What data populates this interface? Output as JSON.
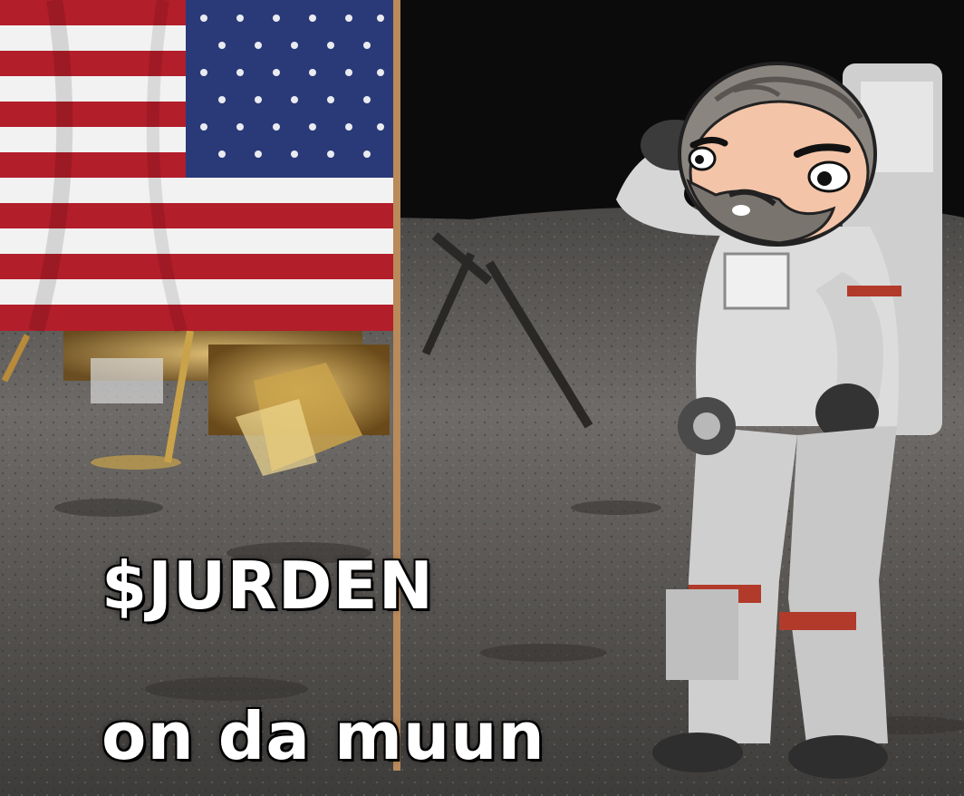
{
  "caption": {
    "line1": "$JURDEN",
    "line2": "on da muun"
  },
  "colors": {
    "sky": "#0b0b0c",
    "lunar_ground": "#6e6b68",
    "flag_red": "#b21e2a",
    "flag_blue": "#2a3a78",
    "suit_white": "#dcdcdc",
    "face_skin": "#f4c4a8",
    "hair_gray": "#8b8580"
  },
  "icons": [
    "flag-icon",
    "astronaut-figure",
    "cartoon-face",
    "lunar-module"
  ]
}
